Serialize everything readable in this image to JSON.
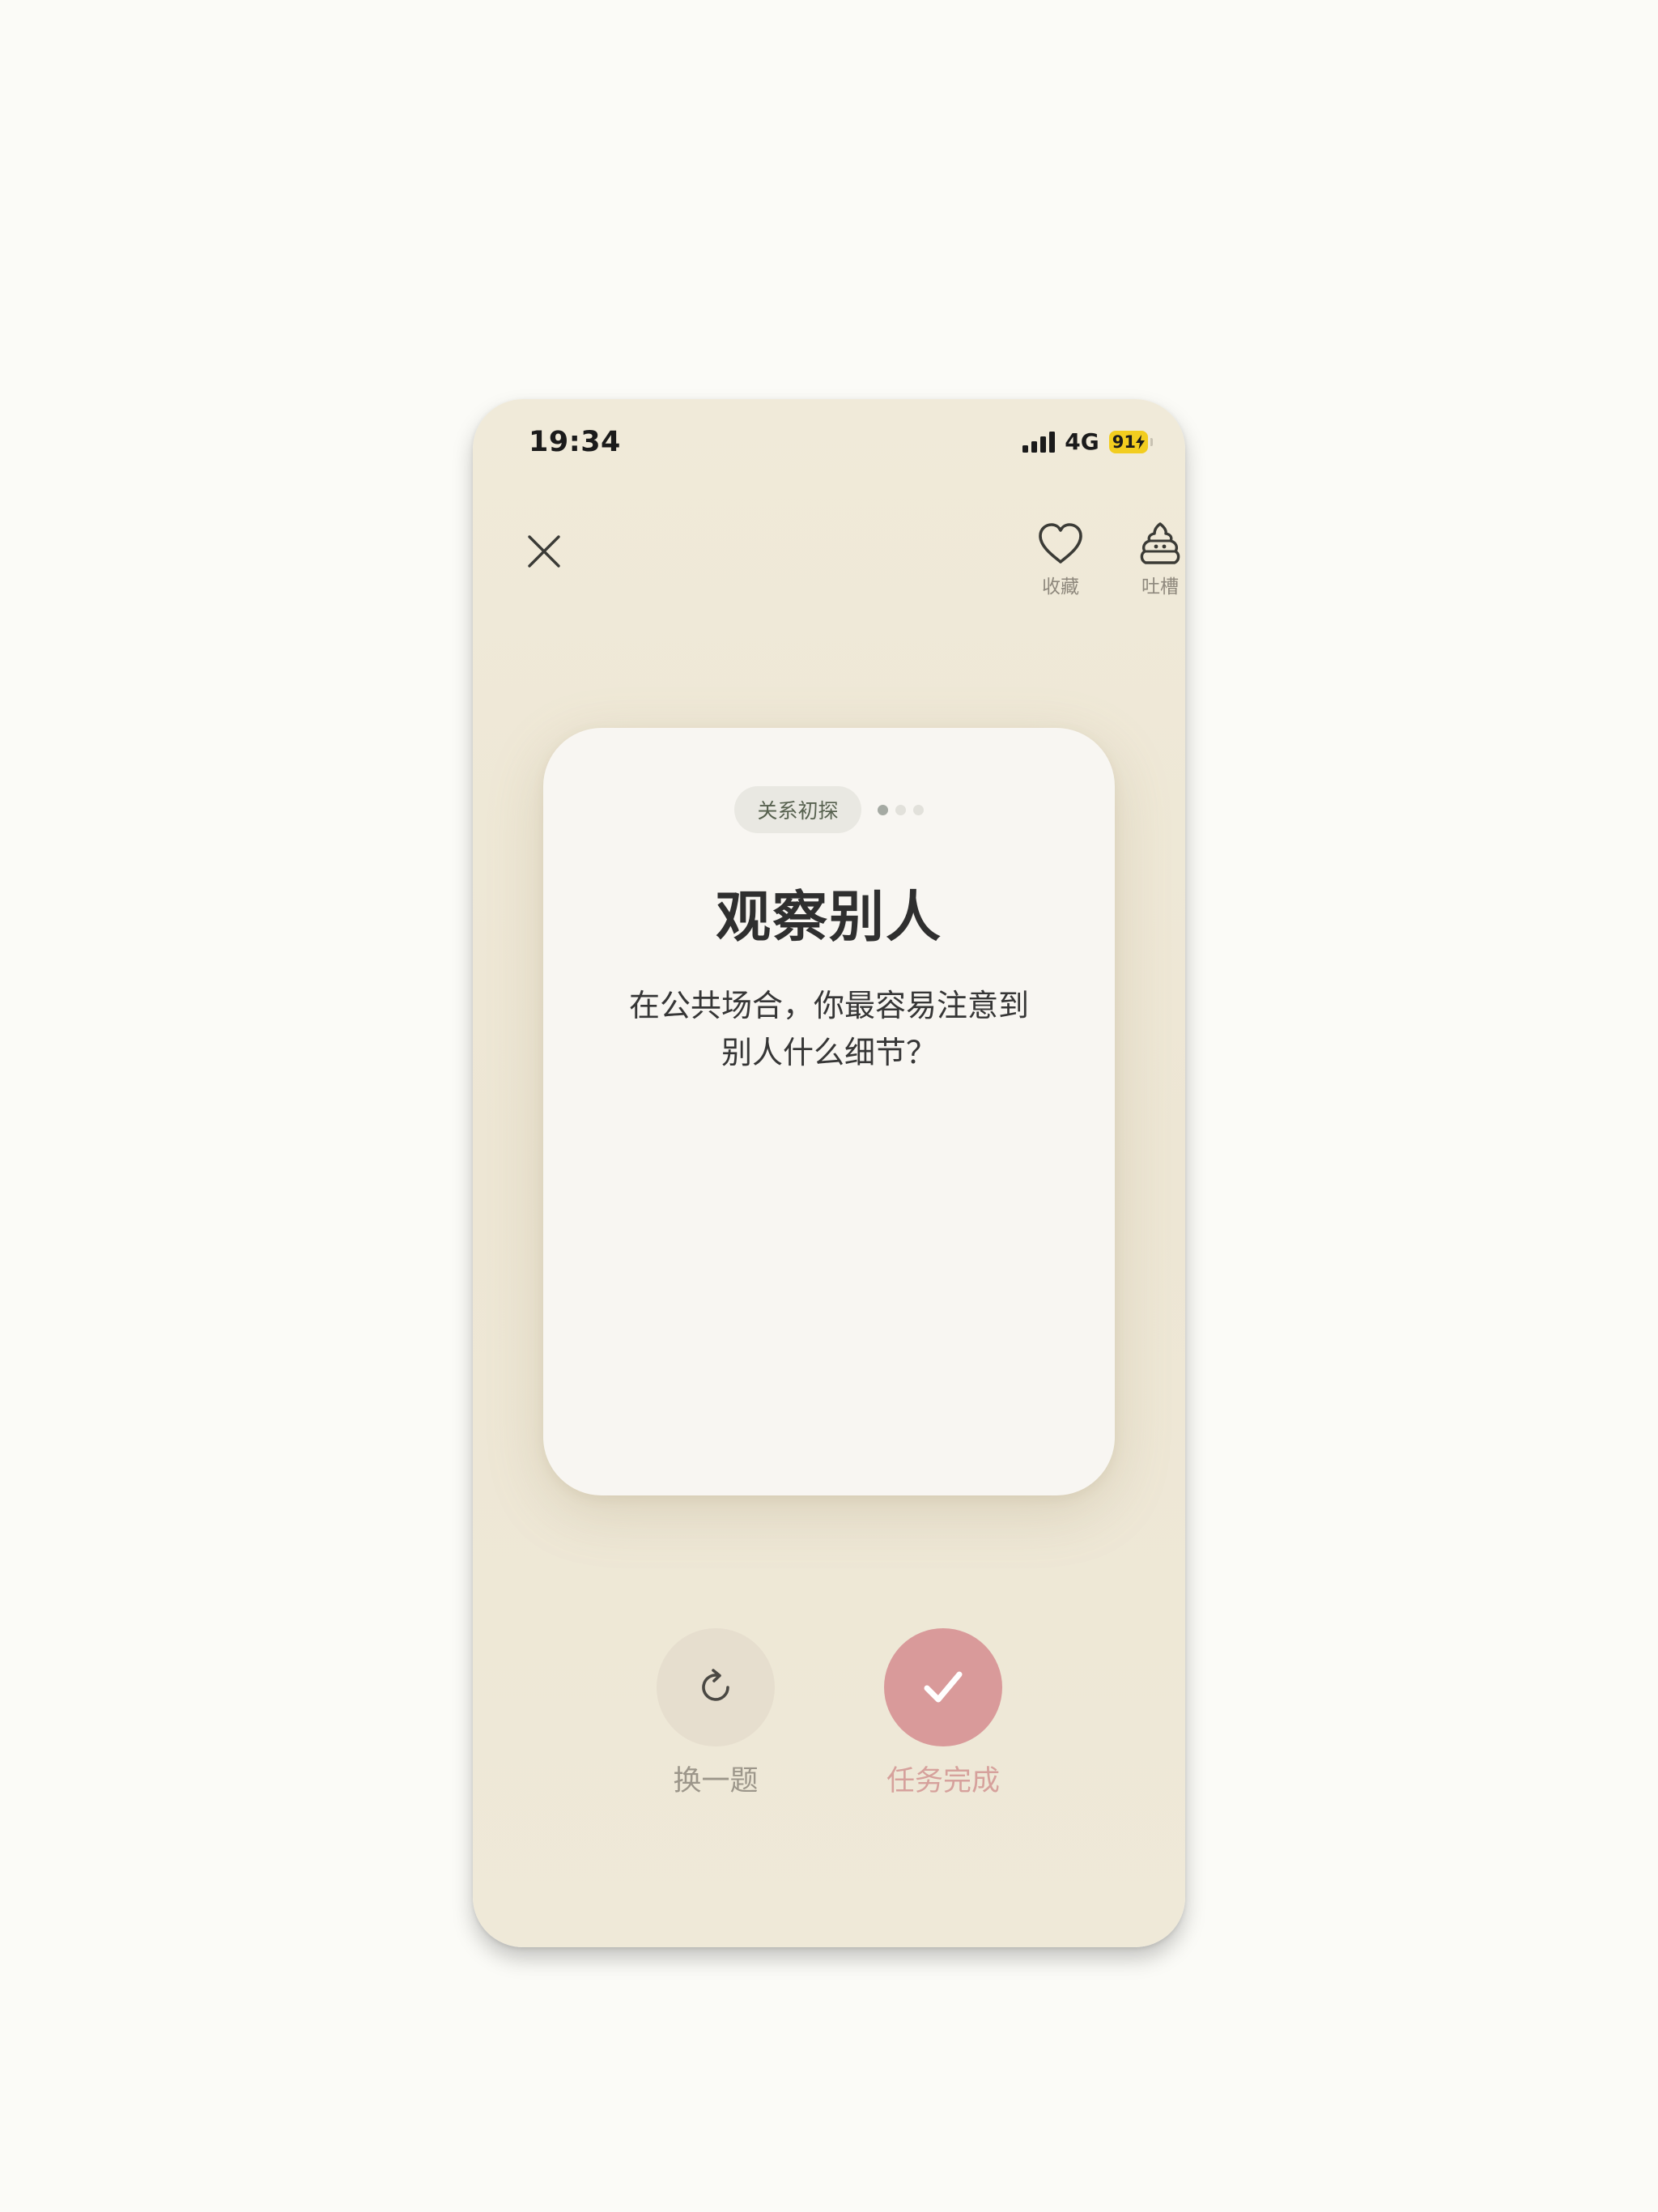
{
  "status_bar": {
    "time": "19:34",
    "network": "4G",
    "battery": "91"
  },
  "top_actions": {
    "favorite_label": "收藏",
    "complain_label": "吐槽"
  },
  "card": {
    "category": "关系初探",
    "title": "观察别人",
    "question": "在公共场合，你最容易注意到别人什么细节？",
    "progress": {
      "current": 1,
      "total": 3
    }
  },
  "bottom_actions": {
    "switch_label": "换一题",
    "complete_label": "任务完成"
  },
  "colors": {
    "background": "#fbfbf7",
    "phone_bg": "#efe9d8",
    "card_bg": "#f8f6f2",
    "accent_pink": "#d99a9a",
    "switch_bg": "#e6dece",
    "battery": "#f2cd1f"
  }
}
